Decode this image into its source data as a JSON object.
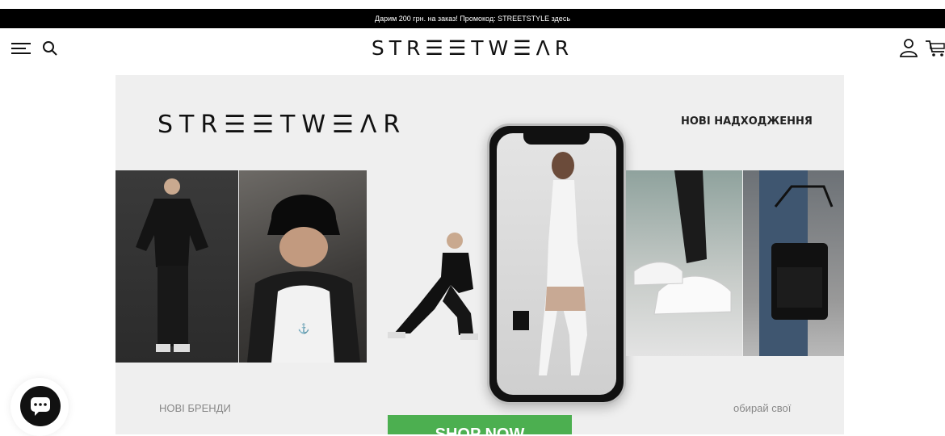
{
  "promo_bar": {
    "text": "Дарим 200 грн. на заказ! Промокод: STREETSTYLE здесь"
  },
  "header": {
    "logo": "STR☰☰TW☰ΛR",
    "icons": [
      "menu-icon",
      "search-icon",
      "user-icon",
      "cart-icon"
    ]
  },
  "banner": {
    "logo": "STR☰☰TW☰ΛR",
    "new_arrivals": "НОВІ НАДХОДЖЕННЯ",
    "new_brands": "НОВІ БРЕНДИ",
    "choose_yours": "обирай свої",
    "shop_button": "SHOP NOW"
  },
  "chat": {
    "icon": "chat-icon"
  },
  "colors": {
    "promo_bg": "#000000",
    "banner_bg": "#efefef",
    "shop_button": "#4caf50"
  }
}
